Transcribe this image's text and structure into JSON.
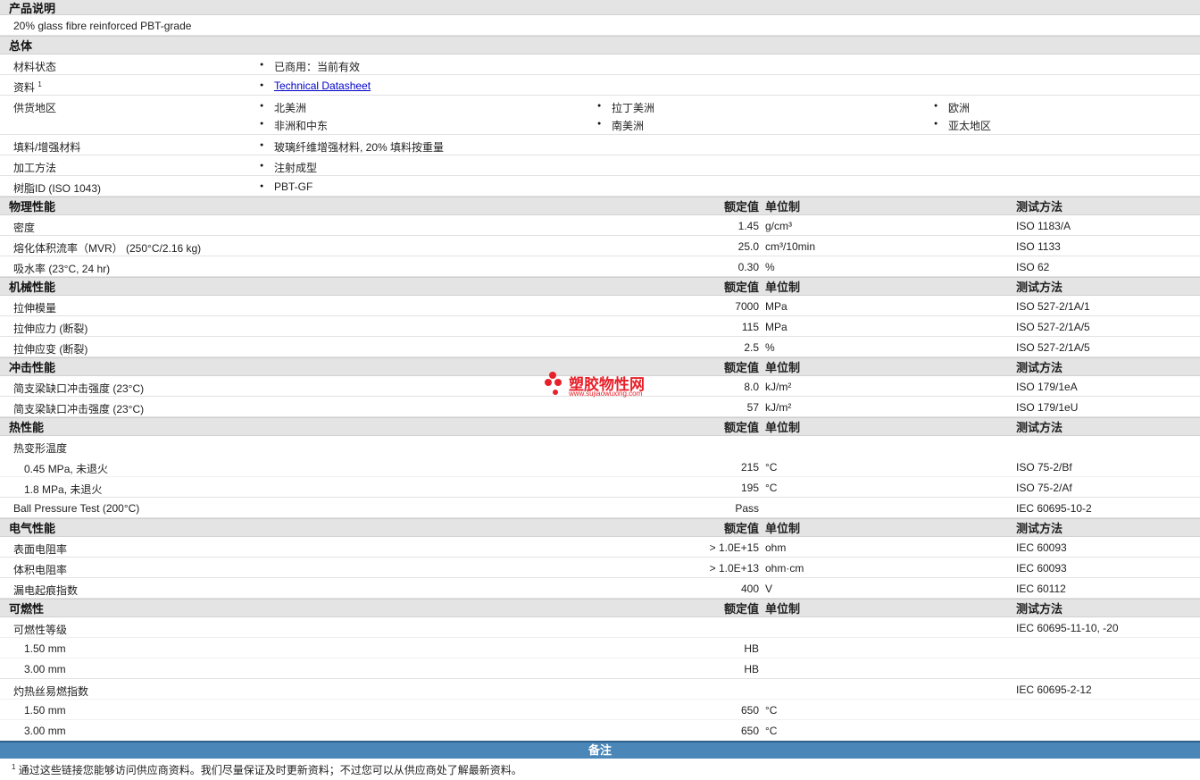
{
  "product_desc": {
    "title": "产品说明",
    "text": "20% glass fibre reinforced PBT-grade"
  },
  "general": {
    "title": "总体",
    "status": {
      "label": "材料状态",
      "value": "已商用：当前有效"
    },
    "docs": {
      "label": "资料",
      "sup": "1",
      "link": "Technical Datasheet"
    },
    "regions": {
      "label": "供货地区",
      "items": [
        "北美洲",
        "拉丁美洲",
        "欧洲",
        "非洲和中东",
        "南美洲",
        "亚太地区"
      ]
    },
    "filler": {
      "label": "填料/增强材料",
      "value": "玻璃纤维增强材料, 20% 填料按重量"
    },
    "process": {
      "label": "加工方法",
      "value": "注射成型"
    },
    "resin": {
      "label": "树脂ID (ISO 1043)",
      "value": "PBT-GF"
    }
  },
  "headers": {
    "nominal": "额定值",
    "unit": "单位制",
    "test": "测试方法"
  },
  "physical": {
    "title": "物理性能",
    "rows": [
      {
        "label": "密度",
        "value": "1.45",
        "unit": "g/cm³",
        "test": "ISO 1183/A"
      },
      {
        "label": "熔化体积流率（MVR） (250°C/2.16 kg)",
        "value": "25.0",
        "unit": "cm³/10min",
        "test": "ISO 1133"
      },
      {
        "label": "吸水率 (23°C, 24 hr)",
        "value": "0.30",
        "unit": "%",
        "test": "ISO 62"
      }
    ]
  },
  "mechanical": {
    "title": "机械性能",
    "rows": [
      {
        "label": "拉伸模量",
        "value": "7000",
        "unit": "MPa",
        "test": "ISO 527-2/1A/1"
      },
      {
        "label": "拉伸应力 (断裂)",
        "value": "115",
        "unit": "MPa",
        "test": "ISO 527-2/1A/5"
      },
      {
        "label": "拉伸应变 (断裂)",
        "value": "2.5",
        "unit": "%",
        "test": "ISO 527-2/1A/5"
      }
    ]
  },
  "impact": {
    "title": "冲击性能",
    "rows": [
      {
        "label": "简支梁缺口冲击强度 (23°C)",
        "value": "8.0",
        "unit": "kJ/m²",
        "test": "ISO 179/1eA"
      },
      {
        "label": "简支梁缺口冲击强度 (23°C)",
        "value": "57",
        "unit": "kJ/m²",
        "test": "ISO 179/1eU"
      }
    ]
  },
  "thermal": {
    "title": "热性能",
    "hdt": {
      "label": "热变形温度"
    },
    "rows": [
      {
        "label": "0.45 MPa, 未退火",
        "value": "215",
        "unit": "°C",
        "test": "ISO 75-2/Bf"
      },
      {
        "label": "1.8 MPa, 未退火",
        "value": "195",
        "unit": "°C",
        "test": "ISO 75-2/Af"
      }
    ],
    "ball": {
      "label": "Ball Pressure Test (200°C)",
      "value": "Pass",
      "test": "IEC 60695-10-2"
    }
  },
  "electrical": {
    "title": "电气性能",
    "rows": [
      {
        "label": "表面电阻率",
        "value": "> 1.0E+15",
        "unit": "ohm",
        "test": "IEC 60093"
      },
      {
        "label": "体积电阻率",
        "value": "> 1.0E+13",
        "unit": "ohm·cm",
        "test": "IEC 60093"
      },
      {
        "label": "漏电起痕指数",
        "value": "400",
        "unit": "V",
        "test": "IEC 60112"
      }
    ]
  },
  "flammability": {
    "title": "可燃性",
    "rating": {
      "label": "可燃性等级",
      "test": "IEC 60695-11-10, -20"
    },
    "rating_rows": [
      {
        "label": "1.50 mm",
        "value": "HB"
      },
      {
        "label": "3.00 mm",
        "value": "HB"
      }
    ],
    "gwfi": {
      "label": "灼热丝易燃指数",
      "test": "IEC 60695-2-12"
    },
    "gwfi_rows": [
      {
        "label": "1.50 mm",
        "value": "650",
        "unit": "°C"
      },
      {
        "label": "3.00 mm",
        "value": "650",
        "unit": "°C"
      }
    ]
  },
  "notes": {
    "title": "备注",
    "sup": "1",
    "text": "通过这些链接您能够访问供应商资料。我们尽量保证及时更新资料；不过您可以从供应商处了解最新资料。"
  },
  "watermark": {
    "cn": "塑胶物性网",
    "url": "www.sujiaowuxing.com",
    "color": "#e8202a"
  }
}
